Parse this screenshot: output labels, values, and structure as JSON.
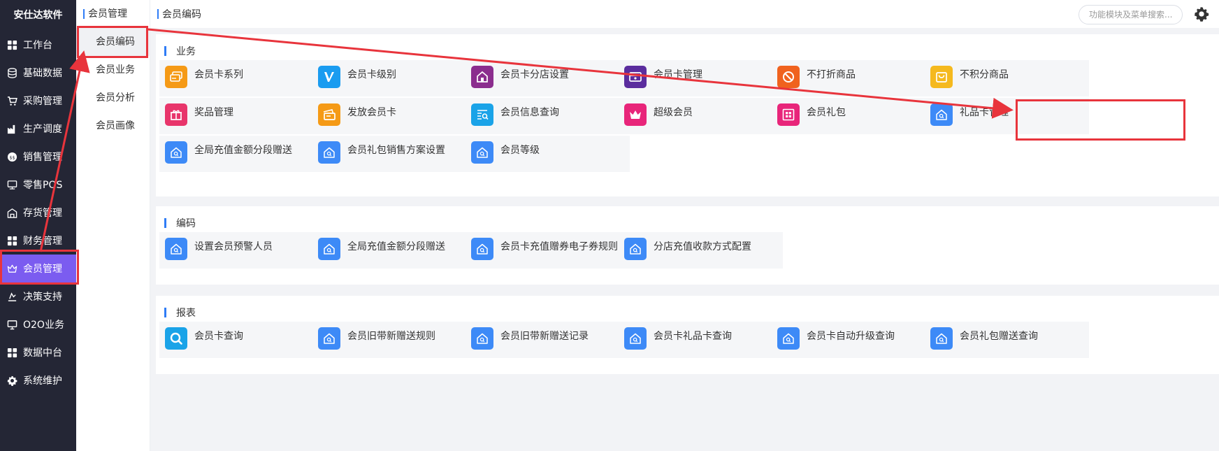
{
  "brand": "安仕达软件",
  "nav": [
    {
      "label": "工作台",
      "icon": "grid-icon",
      "active": false
    },
    {
      "label": "基础数据",
      "icon": "database-icon",
      "active": false
    },
    {
      "label": "采购管理",
      "icon": "cart-icon",
      "active": false
    },
    {
      "label": "生产调度",
      "icon": "factory-icon",
      "active": false
    },
    {
      "label": "销售管理",
      "icon": "sales-badge-icon",
      "active": false
    },
    {
      "label": "零售POS",
      "icon": "pos-icon",
      "active": false
    },
    {
      "label": "存货管理",
      "icon": "warehouse-icon",
      "active": false
    },
    {
      "label": "财务管理",
      "icon": "grid-icon",
      "active": false
    },
    {
      "label": "会员管理",
      "icon": "crown-icon",
      "active": true
    },
    {
      "label": "决策支持",
      "icon": "decision-icon",
      "active": false
    },
    {
      "label": "O2O业务",
      "icon": "monitor-icon",
      "active": false
    },
    {
      "label": "数据中台",
      "icon": "grid-icon",
      "active": false
    },
    {
      "label": "系统维护",
      "icon": "gear-icon",
      "active": false
    }
  ],
  "submenu": {
    "header": "会员管理",
    "items": [
      "会员编码",
      "会员业务",
      "会员分析",
      "会员画像"
    ]
  },
  "breadcrumb": "会员编码",
  "search": {
    "placeholder": "功能模块及菜单搜索..."
  },
  "sections": [
    {
      "title": "业务",
      "tiles": [
        {
          "label": "会员卡系列",
          "icon": "card-series-icon",
          "color": "#f59a16"
        },
        {
          "label": "会员卡级别",
          "icon": "v-level-icon",
          "color": "#1a9cf0"
        },
        {
          "label": "会员卡分店设置",
          "icon": "store-icon",
          "color": "#8b2d8e"
        },
        {
          "label": "会员卡管理",
          "icon": "card-manage-icon",
          "color": "#5b2d9e"
        },
        {
          "label": "不打折商品",
          "icon": "no-discount-icon",
          "color": "#f0621e"
        },
        {
          "label": "不积分商品",
          "icon": "bag-icon",
          "color": "#f5b91e"
        },
        {
          "label": "奖品管理",
          "icon": "gift-icon",
          "color": "#e8356b"
        },
        {
          "label": "发放会员卡",
          "icon": "issue-card-icon",
          "color": "#f59a16"
        },
        {
          "label": "会员信息查询",
          "icon": "search-list-icon",
          "color": "#1aa3e8"
        },
        {
          "label": "超级会员",
          "icon": "crown-icon",
          "color": "#e8257a"
        },
        {
          "label": "会员礼包",
          "icon": "gift-box-icon",
          "color": "#e8257a"
        },
        {
          "label": "礼品卡管理",
          "icon": "home-search-icon",
          "color": "#3d8af7"
        },
        {
          "label": "全局充值金额分段赠送",
          "icon": "home-search-icon",
          "color": "#3d8af7"
        },
        {
          "label": "会员礼包销售方案设置",
          "icon": "home-search-icon",
          "color": "#3d8af7"
        },
        {
          "label": "会员等级",
          "icon": "home-search-icon",
          "color": "#3d8af7"
        }
      ]
    },
    {
      "title": "编码",
      "tiles": [
        {
          "label": "设置会员预警人员",
          "icon": "home-search-icon",
          "color": "#3d8af7"
        },
        {
          "label": "全局充值金额分段赠送",
          "icon": "home-search-icon",
          "color": "#3d8af7"
        },
        {
          "label": "会员卡充值赠券电子券规则",
          "icon": "home-search-icon",
          "color": "#3d8af7"
        },
        {
          "label": "分店充值收款方式配置",
          "icon": "home-search-icon",
          "color": "#3d8af7"
        }
      ]
    },
    {
      "title": "报表",
      "tiles": [
        {
          "label": "会员卡查询",
          "icon": "magnifier-icon",
          "color": "#1aa3e8"
        },
        {
          "label": "会员旧带新赠送规则",
          "icon": "home-search-icon",
          "color": "#3d8af7"
        },
        {
          "label": "会员旧带新赠送记录",
          "icon": "home-search-icon",
          "color": "#3d8af7"
        },
        {
          "label": "会员卡礼品卡查询",
          "icon": "home-search-icon",
          "color": "#3d8af7"
        },
        {
          "label": "会员卡自动升级查询",
          "icon": "home-search-icon",
          "color": "#3d8af7"
        },
        {
          "label": "会员礼包赠送查询",
          "icon": "home-search-icon",
          "color": "#3d8af7"
        }
      ]
    }
  ],
  "annotation_color": "#e8343c"
}
